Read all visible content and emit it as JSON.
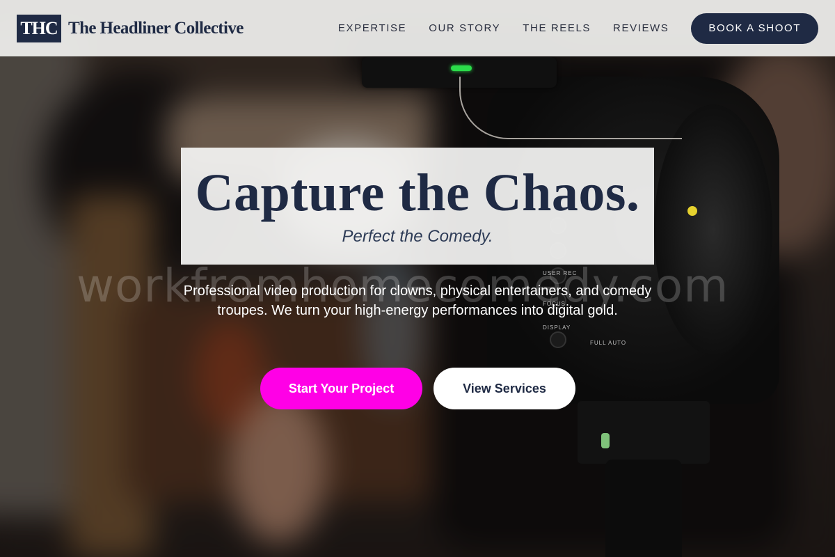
{
  "brand": {
    "mark": "THC",
    "name": "The Headliner Collective",
    "color": "#1f2a44"
  },
  "nav": {
    "items": [
      {
        "label": "EXPERTISE"
      },
      {
        "label": "OUR STORY"
      },
      {
        "label": "THE REELS"
      },
      {
        "label": "REVIEWS"
      }
    ],
    "cta_label": "BOOK A SHOOT"
  },
  "hero": {
    "headline": "Capture the Chaos.",
    "subheadline": "Perfect the Comedy.",
    "description": "Professional video production for clowns, physical entertainers, and comedy troupes. We turn your high-energy performances into digital gold.",
    "primary_cta": "Start Your Project",
    "secondary_cta": "View Services",
    "accent_color": "#ff00e6"
  },
  "watermark": "workfromhomecomedy.com",
  "camera_labels": [
    "USER REC",
    "FOCUS",
    "DISPLAY",
    "FULL AUTO"
  ]
}
